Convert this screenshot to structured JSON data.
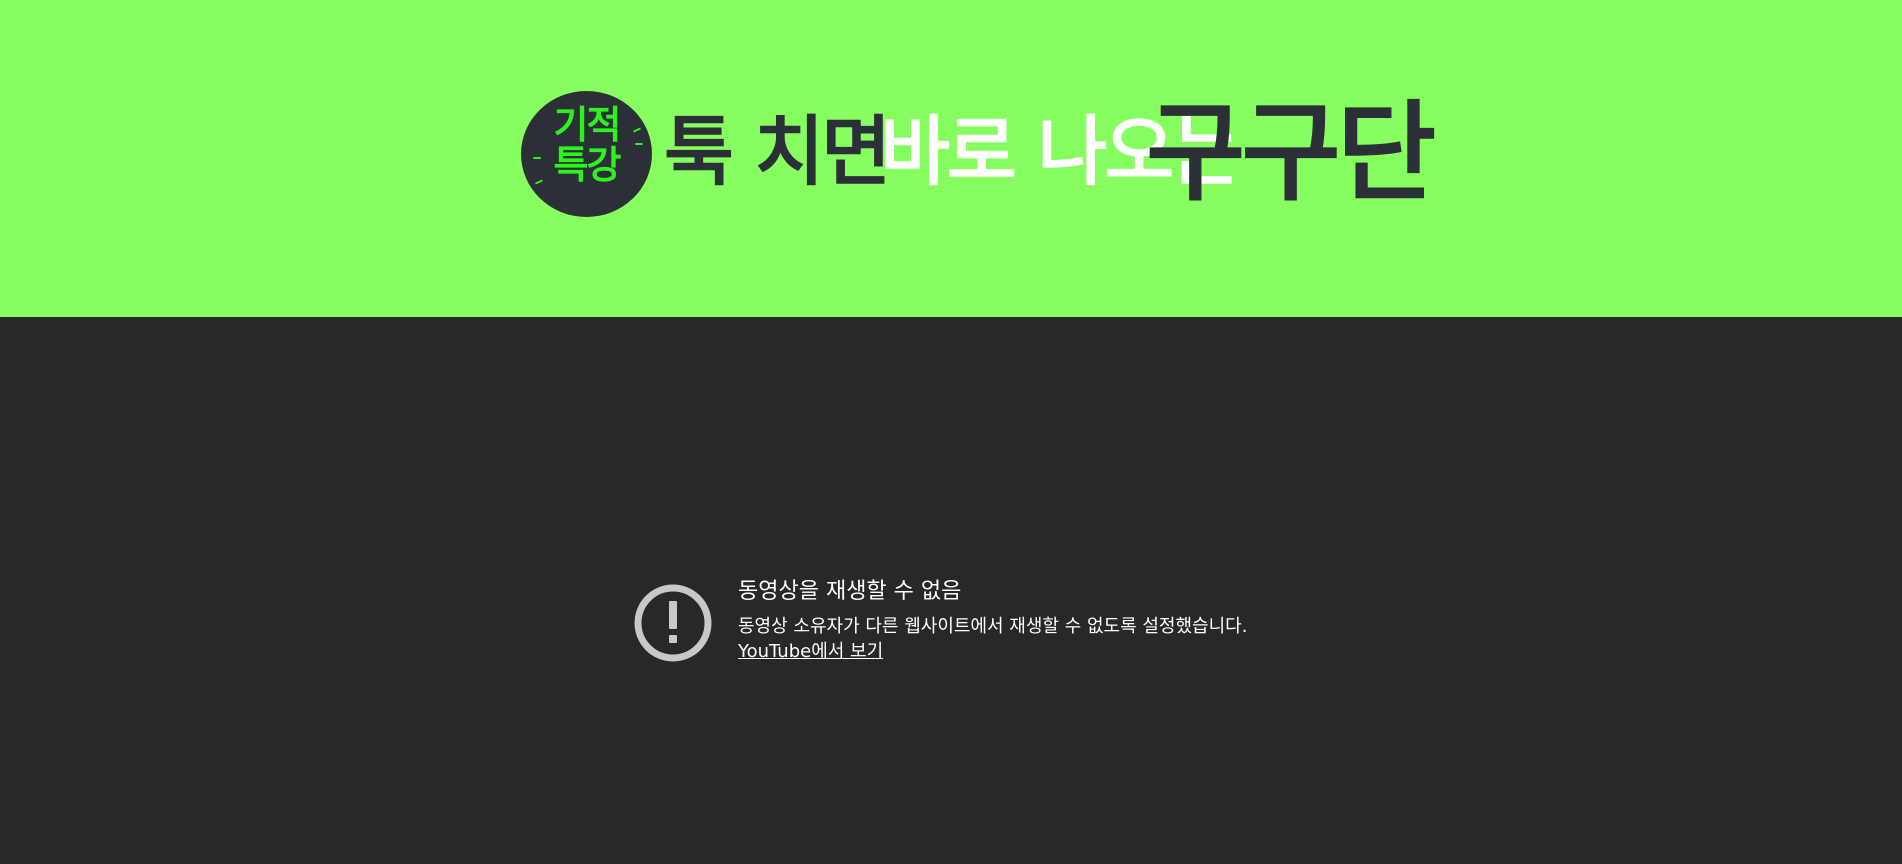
{
  "banner": {
    "background_color": "#86fe5f",
    "badge": {
      "line1": "기적",
      "line2": "특강",
      "badge_color": "#2b2f36",
      "text_color": "#2df21d"
    },
    "headline": {
      "part1": "툭 치면",
      "part2": "바로 나오는",
      "part3": "구구단"
    }
  },
  "player": {
    "background_color": "#282828",
    "error_icon": "exclamation-circle-icon",
    "error_title": "동영상을 재생할 수 없음",
    "error_subtitle": "동영상 소유자가 다른 웹사이트에서 재생할 수 없도록 설정했습니다.",
    "watch_link": "YouTube에서 보기"
  }
}
